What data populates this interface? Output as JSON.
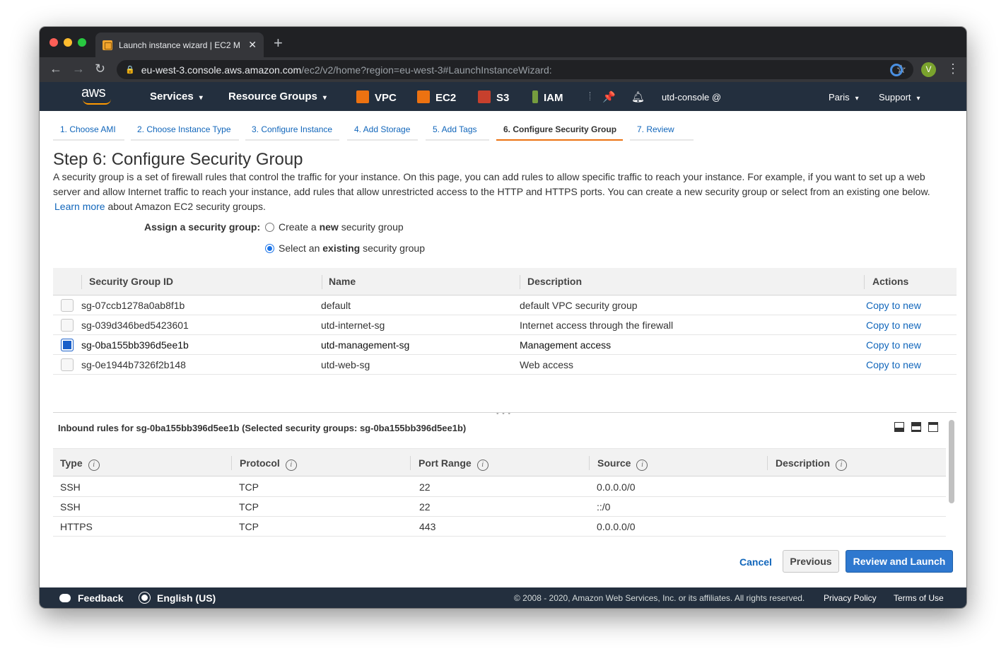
{
  "browser": {
    "tab_title": "Launch instance wizard | EC2 M",
    "url_host": "eu-west-3.console.aws.amazon.com",
    "url_path": "/ec2/v2/home?region=eu-west-3#LaunchInstanceWizard:",
    "avatar_letter": "V"
  },
  "aws_nav": {
    "logo": "aws",
    "services": "Services",
    "resource_groups": "Resource Groups",
    "shortcuts": [
      "VPC",
      "EC2",
      "S3",
      "IAM"
    ],
    "account": "utd-console @",
    "region": "Paris",
    "support": "Support"
  },
  "wizard_steps": [
    "1. Choose AMI",
    "2. Choose Instance Type",
    "3. Configure Instance",
    "4. Add Storage",
    "5. Add Tags",
    "6. Configure Security Group",
    "7. Review"
  ],
  "active_step_index": 5,
  "page": {
    "title": "Step 6: Configure Security Group",
    "description": "A security group is a set of firewall rules that control the traffic for your instance. On this page, you can add rules to allow specific traffic to reach your instance. For example, if you want to set up a web server and allow Internet traffic to reach your instance, add rules that allow unrestricted access to the HTTP and HTTPS ports. You can create a new security group or select from an existing one below.",
    "learn_more": "Learn more",
    "learn_more_suffix": "about Amazon EC2 security groups.",
    "assign_label": "Assign a security group:",
    "radio_create_pre": "Create a",
    "radio_create_bold": "new",
    "radio_create_post": "security group",
    "radio_select_pre": "Select an",
    "radio_select_bold": "existing",
    "radio_select_post": "security group"
  },
  "sg_table": {
    "headers": [
      "Security Group ID",
      "Name",
      "Description",
      "Actions"
    ],
    "rows": [
      {
        "id": "sg-07ccb1278a0ab8f1b",
        "name": "default",
        "description": "default VPC security group",
        "action": "Copy to new",
        "checked": false
      },
      {
        "id": "sg-039d346bed5423601",
        "name": "utd-internet-sg",
        "description": "Internet access through the firewall",
        "action": "Copy to new",
        "checked": false
      },
      {
        "id": "sg-0ba155bb396d5ee1b",
        "name": "utd-management-sg",
        "description": "Management access",
        "action": "Copy to new",
        "checked": true
      },
      {
        "id": "sg-0e1944b7326f2b148",
        "name": "utd-web-sg",
        "description": "Web access",
        "action": "Copy to new",
        "checked": false
      }
    ]
  },
  "inbound": {
    "title": "Inbound rules for sg-0ba155bb396d5ee1b (Selected security groups: sg-0ba155bb396d5ee1b)",
    "headers": [
      "Type",
      "Protocol",
      "Port Range",
      "Source",
      "Description"
    ],
    "rows": [
      {
        "type": "SSH",
        "protocol": "TCP",
        "port": "22",
        "source": "0.0.0.0/0",
        "description": ""
      },
      {
        "type": "SSH",
        "protocol": "TCP",
        "port": "22",
        "source": "::/0",
        "description": ""
      },
      {
        "type": "HTTPS",
        "protocol": "TCP",
        "port": "443",
        "source": "0.0.0.0/0",
        "description": ""
      }
    ]
  },
  "buttons": {
    "cancel": "Cancel",
    "previous": "Previous",
    "review_launch": "Review and Launch"
  },
  "footer": {
    "feedback": "Feedback",
    "language": "English (US)",
    "copyright": "© 2008 - 2020, Amazon Web Services, Inc. or its affiliates. All rights reserved.",
    "privacy": "Privacy Policy",
    "terms": "Terms of Use"
  },
  "colors": {
    "aws_nav_bg": "#232f3e",
    "aws_orange": "#ff9900",
    "link_blue": "#1166bb",
    "primary_button": "#2e78cf",
    "active_step_underline": "#ec7211"
  }
}
